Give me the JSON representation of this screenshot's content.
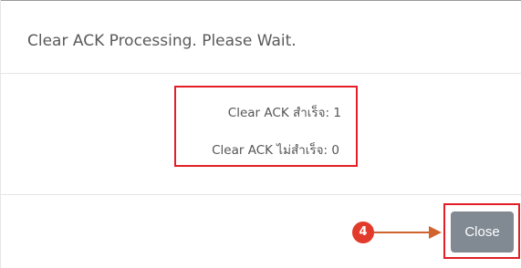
{
  "dialog": {
    "title": "Clear ACK Processing. Please Wait."
  },
  "results": {
    "success_text": "Clear ACK สำเร็จ: 1",
    "fail_text": "Clear ACK ไม่สำเร็จ: 0"
  },
  "annotation": {
    "step_number": "4",
    "highlight_color": "#e31e26",
    "arrow_color": "#d0632e"
  },
  "footer": {
    "close_label": "Close",
    "close_button_color": "#818993"
  }
}
